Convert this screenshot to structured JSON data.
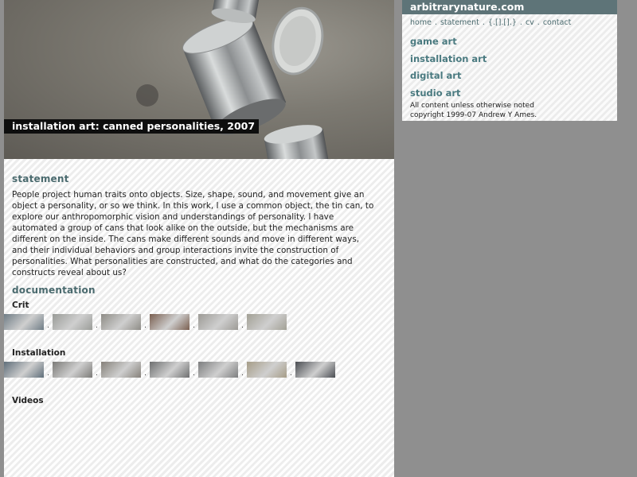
{
  "hero": {
    "caption": "installation art: canned personalities, 2007"
  },
  "statement": {
    "heading": "statement",
    "text": "People project human traits onto objects. Size, shape, sound, and movement give an object a personality, or so we think. In this work, I use a common object, the tin can, to explore our anthropomorphic vision and understandings of personality. I have automated a group of cans that look alike on the outside, but the mechanisms are different on the inside. The cans make different sounds and move in different ways, and their individual behaviors and group interactions invite the construction of personalities. What personalities are constructed, and what do the categories and constructs reveal about us?"
  },
  "documentation": {
    "heading": "documentation",
    "crit_label": "Crit",
    "installation_label": "Installation",
    "videos_label": "Videos",
    "separator": ".",
    "crit_thumbs": [
      {
        "color": "#6f7d86"
      },
      {
        "color": "#9a9c98"
      },
      {
        "color": "#8e8c86"
      },
      {
        "color": "#7a5f50"
      },
      {
        "color": "#9c9a95"
      },
      {
        "color": "#a2a095"
      }
    ],
    "installation_thumbs": [
      {
        "color": "#5f6e7a"
      },
      {
        "color": "#7c7b78"
      },
      {
        "color": "#86817a"
      },
      {
        "color": "#6e6f70"
      },
      {
        "color": "#7d7e7f"
      },
      {
        "color": "#a69d88"
      },
      {
        "color": "#4a4d52"
      }
    ]
  },
  "sidebar": {
    "site_title": "arbitrarynature.com",
    "nav": [
      "home",
      "statement",
      "{.[].[].}",
      "cv",
      "contact"
    ],
    "nav_separator": ".",
    "categories": [
      "game art",
      "installation art",
      "digital art",
      "studio art"
    ],
    "footer_line1": "All content unless otherwise noted",
    "footer_line2": "copyright 1999-07 Andrew Y Ames."
  },
  "colors": {
    "page_bg": "#8f8f8f",
    "sidebar_header": "#5e7478",
    "heading": "#4a6a6e",
    "caption_bg": "#0e0e0e"
  }
}
